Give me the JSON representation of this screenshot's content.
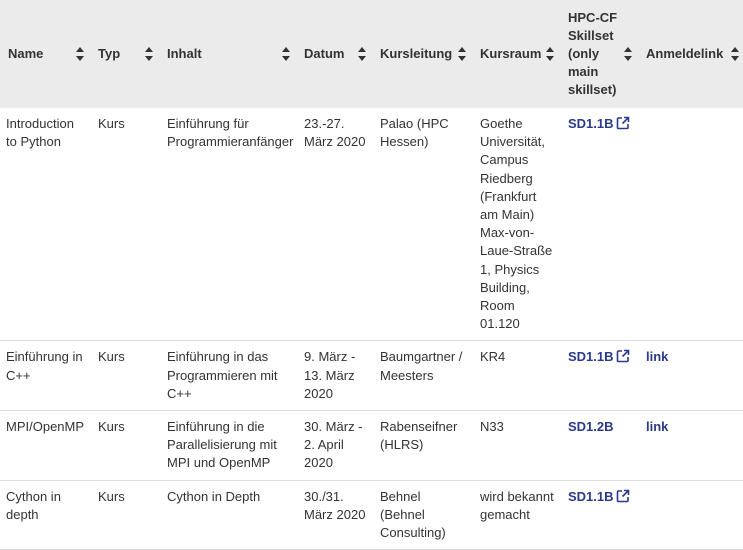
{
  "table": {
    "headers": {
      "name": "Name",
      "typ": "Typ",
      "inhalt": "Inhalt",
      "datum": "Datum",
      "kursleitung": "Kursleitung",
      "kursraum": "Kursraum",
      "skillset": "HPC-CF Skillset (only main skillset)",
      "anmeldelink": "Anmeldelink"
    },
    "rows": [
      {
        "name": "Introduction to Python",
        "typ": "Kurs",
        "inhalt": "Einführung für Programmieranfänger",
        "datum": "23.-27. März 2020",
        "kursleitung": "Palao (HPC Hessen)",
        "kursraum": "Goethe Universität, Campus Riedberg (Frankfurt am Main) Max-von-Laue-Straße 1, Physics Building, Room 01.120",
        "skillset": "SD1.1B",
        "skillset_external": true,
        "anmeldelink": ""
      },
      {
        "name": "Einführung in C++",
        "typ": "Kurs",
        "inhalt": "Einführung in das Programmieren mit C++",
        "datum": "9. März - 13. März 2020",
        "kursleitung": "Baumgartner / Meesters",
        "kursraum": "KR4",
        "skillset": "SD1.1B",
        "skillset_external": true,
        "anmeldelink": "link"
      },
      {
        "name": "MPI/OpenMP",
        "typ": "Kurs",
        "inhalt": "Einführung in die Parallelisierung mit MPI und OpenMP",
        "datum": "30. März - 2. April 2020",
        "kursleitung": "Rabenseifner (HLRS)",
        "kursraum": "N33",
        "skillset": "SD1.2B",
        "skillset_external": false,
        "anmeldelink": "link"
      },
      {
        "name": "Cython in depth",
        "typ": "Kurs",
        "inhalt": "Cython in Depth",
        "datum": "30./31. März 2020",
        "kursleitung": "Behnel (Behnel Consulting)",
        "kursraum": "wird bekannt gemacht",
        "skillset": "SD1.1B",
        "skillset_external": true,
        "anmeldelink": ""
      }
    ]
  },
  "colors": {
    "header_bg": "#ebebeb",
    "link": "#2b3a8c",
    "text": "#333333",
    "border": "#dddddd"
  },
  "icons": {
    "sort": "sort-icon",
    "external": "external-link-icon"
  }
}
